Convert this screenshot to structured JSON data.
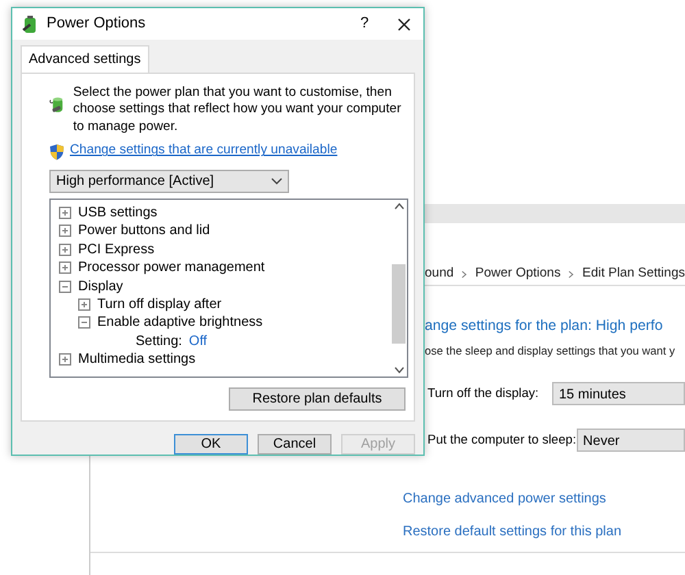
{
  "dialog": {
    "title": "Power Options",
    "help_button": "?",
    "tabs": [
      {
        "label": "Advanced settings",
        "selected": true
      }
    ],
    "intro": "Select the power plan that you want to customise, then choose settings that reflect how you want your computer to manage power.",
    "admin_link": "Change settings that are currently unavailable",
    "plan_select": {
      "value": "High performance [Active]"
    },
    "tree": [
      {
        "kind": "group",
        "label": "USB settings",
        "expanded": false
      },
      {
        "kind": "group",
        "label": "Power buttons and lid",
        "expanded": false
      },
      {
        "kind": "group",
        "label": "PCI Express",
        "expanded": false
      },
      {
        "kind": "group",
        "label": "Processor power management",
        "expanded": false
      },
      {
        "kind": "group",
        "label": "Display",
        "expanded": true,
        "children": [
          {
            "kind": "group",
            "label": "Turn off display after",
            "expanded": false
          },
          {
            "kind": "group",
            "label": "Enable adaptive brightness",
            "expanded": true,
            "children": [
              {
                "kind": "setting",
                "label": "Setting:",
                "value": "Off"
              }
            ]
          }
        ]
      },
      {
        "kind": "group",
        "label": "Multimedia settings",
        "expanded": false
      }
    ],
    "restore_button": "Restore plan defaults",
    "buttons": [
      {
        "label": "OK",
        "default": true,
        "disabled": false
      },
      {
        "label": "Cancel",
        "default": false,
        "disabled": false
      },
      {
        "label": "Apply",
        "default": false,
        "disabled": true
      }
    ]
  },
  "background_window": {
    "breadcrumb": [
      "ound",
      "Power Options",
      "Edit Plan Settings"
    ],
    "heading": "ange settings for the plan: High perfo",
    "description": "ose the sleep and display settings that you want y",
    "settings": [
      {
        "label": "Turn off the display:",
        "value": "15 minutes"
      },
      {
        "label": "Put the computer to sleep:",
        "value": "Never"
      }
    ],
    "links": [
      "Change advanced power settings",
      "Restore default settings for this plan"
    ]
  }
}
